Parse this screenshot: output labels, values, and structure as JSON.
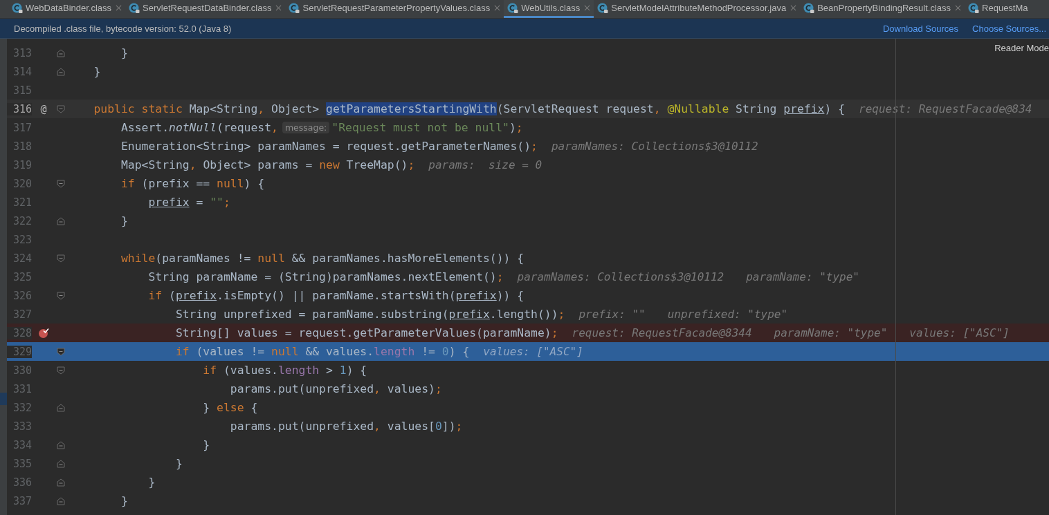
{
  "tabs": [
    {
      "label": "WebDataBinder.class",
      "selected": false,
      "closable": true
    },
    {
      "label": "ServletRequestDataBinder.class",
      "selected": false,
      "closable": true
    },
    {
      "label": "ServletRequestParameterPropertyValues.class",
      "selected": false,
      "closable": true
    },
    {
      "label": "WebUtils.class",
      "selected": true,
      "closable": true
    },
    {
      "label": "ServletModelAttributeMethodProcessor.java",
      "selected": false,
      "closable": true
    },
    {
      "label": "BeanPropertyBindingResult.class",
      "selected": false,
      "closable": true
    },
    {
      "label": "RequestMa",
      "selected": false,
      "closable": false
    }
  ],
  "banner": {
    "message": "Decompiled .class file, bytecode version: 52.0 (Java 8)",
    "links": [
      "Download Sources",
      "Choose Sources..."
    ]
  },
  "reader_mode": "Reader Mode",
  "lines": [
    {
      "number": "313",
      "fold_open": false,
      "fold_close": true,
      "current": false,
      "breakpoint": false,
      "execution": false,
      "segments": [
        {
          "kind": "code",
          "tokens": [
            {
              "kind": "plain",
              "text": "        }"
            }
          ]
        }
      ]
    },
    {
      "number": "314",
      "fold_open": false,
      "fold_close": true,
      "current": false,
      "breakpoint": false,
      "execution": false,
      "segments": [
        {
          "kind": "code",
          "tokens": [
            {
              "kind": "plain",
              "text": "    }"
            }
          ]
        }
      ]
    },
    {
      "number": "315",
      "fold_open": false,
      "fold_close": false,
      "current": false,
      "breakpoint": false,
      "execution": false
    },
    {
      "number": "316",
      "fold_open": true,
      "fold_close": false,
      "current": true,
      "breakpoint": false,
      "execution": false,
      "marker": "@",
      "segments": [
        {
          "kind": "code",
          "tokens": [
            {
              "kind": "kw",
              "text": "    public static "
            },
            {
              "kind": "plain",
              "text": "Map<String"
            },
            {
              "kind": "punct",
              "text": ", "
            },
            {
              "kind": "plain",
              "text": "Object> "
            },
            {
              "kind": "sel",
              "text": "getParametersStartingWith"
            },
            {
              "kind": "plain",
              "text": "(ServletRequest request"
            },
            {
              "kind": "punct",
              "text": ", "
            },
            {
              "kind": "ann",
              "text": "@Nullable"
            },
            {
              "kind": "plain",
              "text": " String "
            },
            {
              "kind": "under",
              "text": "prefix"
            },
            {
              "kind": "plain",
              "text": ") {"
            }
          ]
        },
        {
          "kind": "hint",
          "text": "request: RequestFacade@834"
        }
      ]
    },
    {
      "number": "317",
      "fold_open": false,
      "fold_close": false,
      "current": false,
      "breakpoint": false,
      "execution": false,
      "segments": [
        {
          "kind": "code",
          "tokens": [
            {
              "kind": "plain",
              "text": "        Assert."
            },
            {
              "kind": "italic",
              "text": "notNull"
            },
            {
              "kind": "plain",
              "text": "(request"
            },
            {
              "kind": "punct",
              "text": ","
            }
          ]
        },
        {
          "kind": "param",
          "text": "message:"
        },
        {
          "kind": "code",
          "tokens": [
            {
              "kind": "str",
              "text": "\"Request must not be null\""
            },
            {
              "kind": "plain",
              "text": ")"
            },
            {
              "kind": "punct",
              "text": ";"
            }
          ]
        }
      ]
    },
    {
      "number": "318",
      "fold_open": false,
      "fold_close": false,
      "current": false,
      "breakpoint": false,
      "execution": false,
      "segments": [
        {
          "kind": "code",
          "tokens": [
            {
              "kind": "plain",
              "text": "        Enumeration<String> paramNames = request.getParameterNames()"
            },
            {
              "kind": "punct",
              "text": ";"
            }
          ]
        },
        {
          "kind": "hint",
          "text": "paramNames: Collections$3@10112"
        }
      ]
    },
    {
      "number": "319",
      "fold_open": false,
      "fold_close": false,
      "current": false,
      "breakpoint": false,
      "execution": false,
      "segments": [
        {
          "kind": "code",
          "tokens": [
            {
              "kind": "plain",
              "text": "        Map<String"
            },
            {
              "kind": "punct",
              "text": ", "
            },
            {
              "kind": "plain",
              "text": "Object> params = "
            },
            {
              "kind": "kw",
              "text": "new"
            },
            {
              "kind": "plain",
              "text": " TreeMap()"
            },
            {
              "kind": "punct",
              "text": ";"
            }
          ]
        },
        {
          "kind": "hint",
          "text": "params:  size = 0"
        }
      ]
    },
    {
      "number": "320",
      "fold_open": true,
      "fold_close": false,
      "current": false,
      "breakpoint": false,
      "execution": false,
      "segments": [
        {
          "kind": "code",
          "tokens": [
            {
              "kind": "kw",
              "text": "        if"
            },
            {
              "kind": "plain",
              "text": " (prefix == "
            },
            {
              "kind": "kw",
              "text": "null"
            },
            {
              "kind": "plain",
              "text": ") {"
            }
          ]
        }
      ]
    },
    {
      "number": "321",
      "fold_open": false,
      "fold_close": false,
      "current": false,
      "breakpoint": false,
      "execution": false,
      "segments": [
        {
          "kind": "code",
          "tokens": [
            {
              "kind": "under",
              "text": "            prefix"
            },
            {
              "kind": "plain",
              "text": " = "
            },
            {
              "kind": "str",
              "text": "\"\""
            },
            {
              "kind": "punct",
              "text": ";"
            }
          ]
        }
      ]
    },
    {
      "number": "322",
      "fold_open": false,
      "fold_close": true,
      "current": false,
      "breakpoint": false,
      "execution": false,
      "segments": [
        {
          "kind": "code",
          "tokens": [
            {
              "kind": "plain",
              "text": "        }"
            }
          ]
        }
      ]
    },
    {
      "number": "323",
      "fold_open": false,
      "fold_close": false,
      "current": false,
      "breakpoint": false,
      "execution": false
    },
    {
      "number": "324",
      "fold_open": true,
      "fold_close": false,
      "current": false,
      "breakpoint": false,
      "execution": false,
      "segments": [
        {
          "kind": "code",
          "tokens": [
            {
              "kind": "kw",
              "text": "        while"
            },
            {
              "kind": "plain",
              "text": "(paramNames != "
            },
            {
              "kind": "kw",
              "text": "null"
            },
            {
              "kind": "plain",
              "text": " && paramNames.hasMoreElements()) {"
            }
          ]
        }
      ]
    },
    {
      "number": "325",
      "fold_open": false,
      "fold_close": false,
      "current": false,
      "breakpoint": false,
      "execution": false,
      "segments": [
        {
          "kind": "code",
          "tokens": [
            {
              "kind": "plain",
              "text": "            String paramName = (String)paramNames.nextElement()"
            },
            {
              "kind": "punct",
              "text": ";"
            }
          ]
        },
        {
          "kind": "hint",
          "text": "paramNames: Collections$3@10112"
        },
        {
          "kind": "hint",
          "text": "paramName: \"type\""
        }
      ]
    },
    {
      "number": "326",
      "fold_open": true,
      "fold_close": false,
      "current": false,
      "breakpoint": false,
      "execution": false,
      "segments": [
        {
          "kind": "code",
          "tokens": [
            {
              "kind": "kw",
              "text": "            if"
            },
            {
              "kind": "plain",
              "text": " ("
            },
            {
              "kind": "under",
              "text": "prefix"
            },
            {
              "kind": "plain",
              "text": ".isEmpty() || paramName.startsWith("
            },
            {
              "kind": "under",
              "text": "prefix"
            },
            {
              "kind": "plain",
              "text": ")) {"
            }
          ]
        }
      ]
    },
    {
      "number": "327",
      "fold_open": false,
      "fold_close": false,
      "current": false,
      "breakpoint": false,
      "execution": false,
      "segments": [
        {
          "kind": "code",
          "tokens": [
            {
              "kind": "plain",
              "text": "                String unprefixed = paramName.substring("
            },
            {
              "kind": "under",
              "text": "prefix"
            },
            {
              "kind": "plain",
              "text": ".length())"
            },
            {
              "kind": "punct",
              "text": ";"
            }
          ]
        },
        {
          "kind": "hint",
          "text": "prefix: \"\""
        },
        {
          "kind": "hint",
          "text": "unprefixed: \"type\""
        }
      ]
    },
    {
      "number": "328",
      "fold_open": false,
      "fold_close": false,
      "current": false,
      "breakpoint": true,
      "execution": false,
      "segments": [
        {
          "kind": "code",
          "tokens": [
            {
              "kind": "plain",
              "text": "                String[] values = request.getParameterValues(paramName)"
            },
            {
              "kind": "punct",
              "text": ";"
            }
          ]
        },
        {
          "kind": "hint",
          "text": "request: RequestFacade@8344"
        },
        {
          "kind": "hint",
          "text": "paramName: \"type\""
        },
        {
          "kind": "hint",
          "text": "values: [\"ASC\"]"
        }
      ]
    },
    {
      "number": "329",
      "fold_open": true,
      "fold_close": false,
      "current": false,
      "breakpoint": false,
      "execution": true,
      "segments": [
        {
          "kind": "code",
          "tokens": [
            {
              "kind": "kw",
              "text": "                if"
            },
            {
              "kind": "plain",
              "text": " (values != "
            },
            {
              "kind": "kw",
              "text": "null"
            },
            {
              "kind": "plain",
              "text": " && values."
            },
            {
              "kind": "field",
              "text": "length"
            },
            {
              "kind": "plain",
              "text": " != "
            },
            {
              "kind": "num",
              "text": "0"
            },
            {
              "kind": "plain",
              "text": ") {"
            }
          ]
        },
        {
          "kind": "hint",
          "text": "values: [\"ASC\"]"
        }
      ]
    },
    {
      "number": "330",
      "fold_open": true,
      "fold_close": false,
      "current": false,
      "breakpoint": false,
      "execution": false,
      "segments": [
        {
          "kind": "code",
          "tokens": [
            {
              "kind": "kw",
              "text": "                    if"
            },
            {
              "kind": "plain",
              "text": " (values."
            },
            {
              "kind": "field",
              "text": "length"
            },
            {
              "kind": "plain",
              "text": " > "
            },
            {
              "kind": "num",
              "text": "1"
            },
            {
              "kind": "plain",
              "text": ") {"
            }
          ]
        }
      ]
    },
    {
      "number": "331",
      "fold_open": false,
      "fold_close": false,
      "current": false,
      "breakpoint": false,
      "execution": false,
      "segments": [
        {
          "kind": "code",
          "tokens": [
            {
              "kind": "plain",
              "text": "                        params.put(unprefixed"
            },
            {
              "kind": "punct",
              "text": ", "
            },
            {
              "kind": "plain",
              "text": "values)"
            },
            {
              "kind": "punct",
              "text": ";"
            }
          ]
        }
      ]
    },
    {
      "number": "332",
      "fold_open": false,
      "fold_close": true,
      "current": false,
      "breakpoint": false,
      "execution": false,
      "segments": [
        {
          "kind": "code",
          "tokens": [
            {
              "kind": "plain",
              "text": "                    } "
            },
            {
              "kind": "kw",
              "text": "else"
            },
            {
              "kind": "plain",
              "text": " {"
            }
          ]
        }
      ]
    },
    {
      "number": "333",
      "fold_open": false,
      "fold_close": false,
      "current": false,
      "breakpoint": false,
      "execution": false,
      "segments": [
        {
          "kind": "code",
          "tokens": [
            {
              "kind": "plain",
              "text": "                        params.put(unprefixed"
            },
            {
              "kind": "punct",
              "text": ", "
            },
            {
              "kind": "plain",
              "text": "values["
            },
            {
              "kind": "num",
              "text": "0"
            },
            {
              "kind": "plain",
              "text": "])"
            },
            {
              "kind": "punct",
              "text": ";"
            }
          ]
        }
      ]
    },
    {
      "number": "334",
      "fold_open": false,
      "fold_close": true,
      "current": false,
      "breakpoint": false,
      "execution": false,
      "segments": [
        {
          "kind": "code",
          "tokens": [
            {
              "kind": "plain",
              "text": "                    }"
            }
          ]
        }
      ]
    },
    {
      "number": "335",
      "fold_open": false,
      "fold_close": true,
      "current": false,
      "breakpoint": false,
      "execution": false,
      "segments": [
        {
          "kind": "code",
          "tokens": [
            {
              "kind": "plain",
              "text": "                }"
            }
          ]
        }
      ]
    },
    {
      "number": "336",
      "fold_open": false,
      "fold_close": true,
      "current": false,
      "breakpoint": false,
      "execution": false,
      "segments": [
        {
          "kind": "code",
          "tokens": [
            {
              "kind": "plain",
              "text": "            }"
            }
          ]
        }
      ]
    },
    {
      "number": "337",
      "fold_open": false,
      "fold_close": true,
      "current": false,
      "breakpoint": false,
      "execution": false,
      "segments": [
        {
          "kind": "code",
          "tokens": [
            {
              "kind": "plain",
              "text": "        }"
            }
          ]
        }
      ]
    }
  ]
}
